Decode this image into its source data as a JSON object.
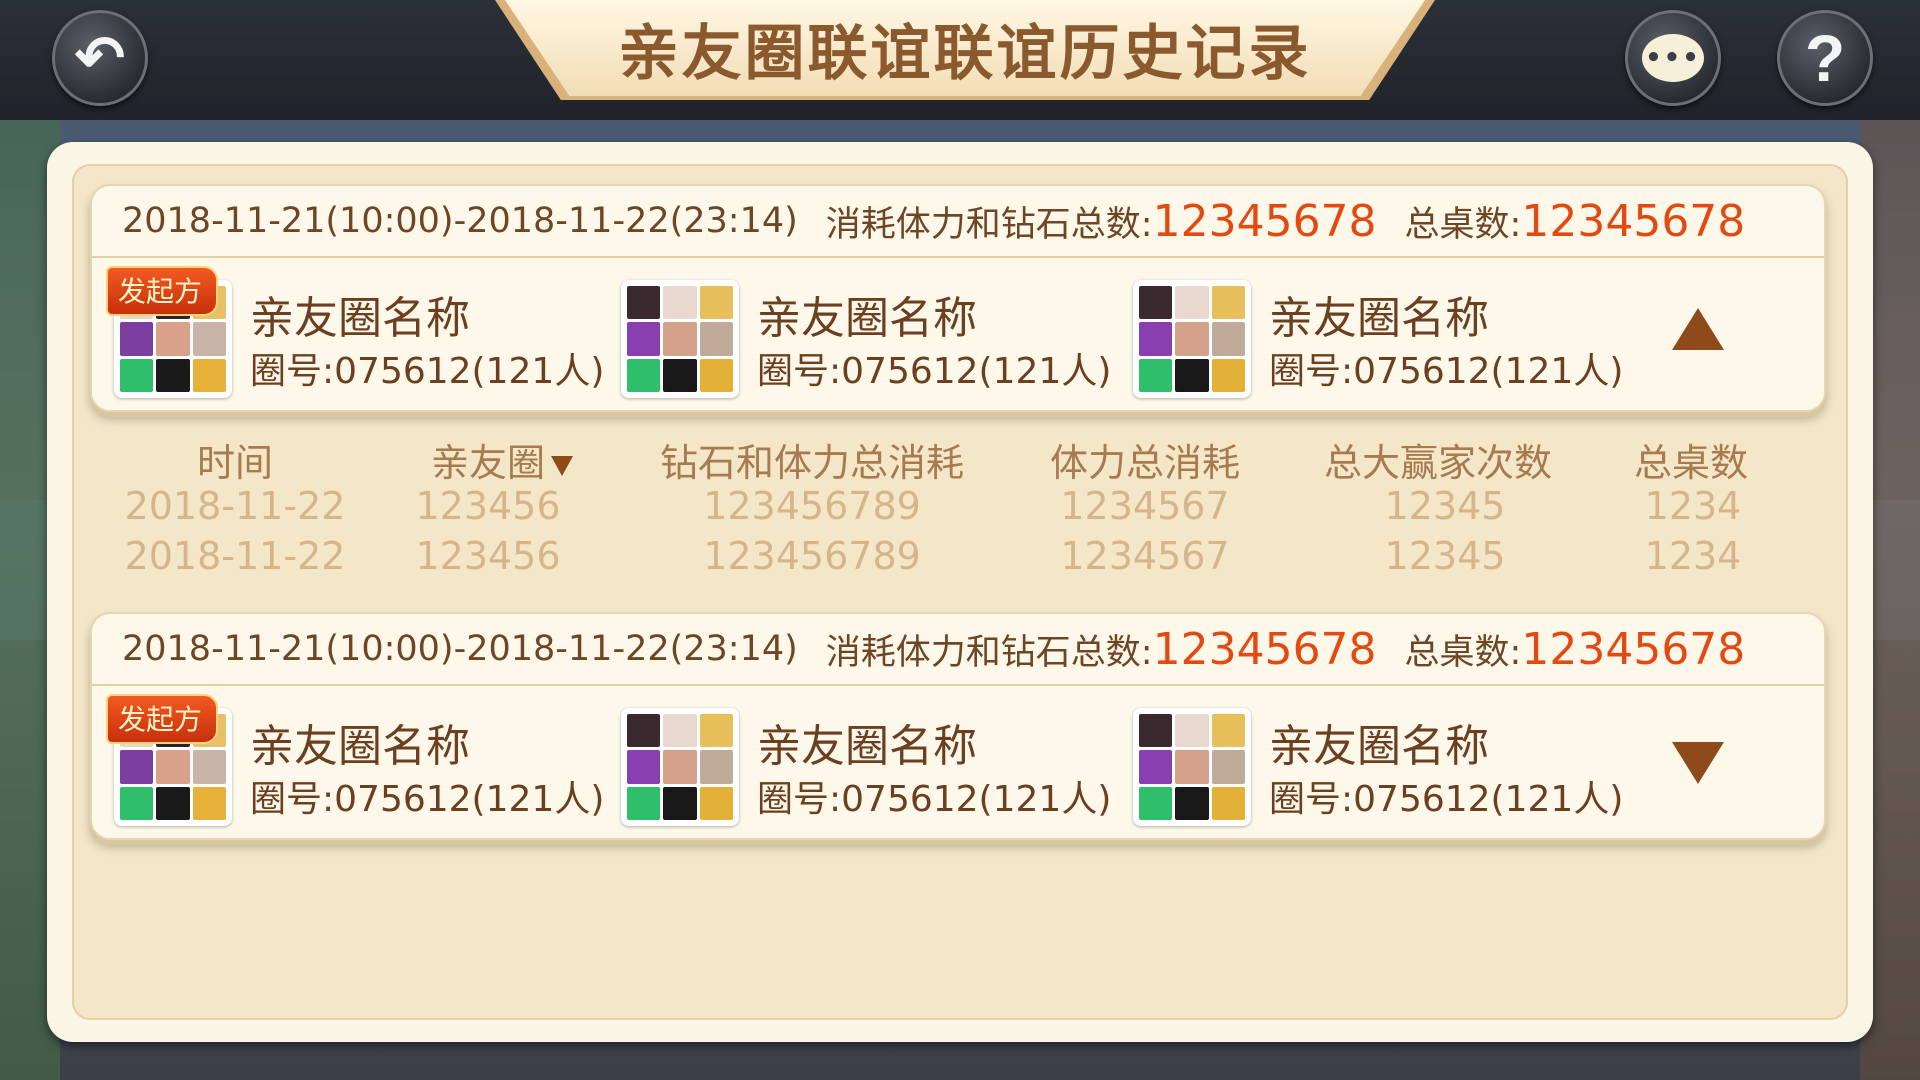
{
  "title": "亲友圈联谊联谊历史记录",
  "topbar": {
    "back_glyph": "↶",
    "chat_glyph": "•••",
    "help_glyph": "?"
  },
  "records": [
    {
      "period": "2018-11-21(10:00)-2018-11-22(23:14)",
      "consumption_label": "消耗体力和钻石总数:",
      "consumption_value": "12345678",
      "tables_label": "总桌数:",
      "tables_value": "12345678",
      "initiator_label": "发起方",
      "clubs": [
        {
          "name": "亲友圈名称",
          "id": "圈号:075612(121人)"
        },
        {
          "name": "亲友圈名称",
          "id": "圈号:075612(121人)"
        },
        {
          "name": "亲友圈名称",
          "id": "圈号:075612(121人)"
        }
      ],
      "toggle": "up"
    },
    {
      "period": "2018-11-21(10:00)-2018-11-22(23:14)",
      "consumption_label": "消耗体力和钻石总数:",
      "consumption_value": "12345678",
      "tables_label": "总桌数:",
      "tables_value": "12345678",
      "initiator_label": "发起方",
      "clubs": [
        {
          "name": "亲友圈名称",
          "id": "圈号:075612(121人)"
        },
        {
          "name": "亲友圈名称",
          "id": "圈号:075612(121人)"
        },
        {
          "name": "亲友圈名称",
          "id": "圈号:075612(121人)"
        }
      ],
      "toggle": "down"
    }
  ],
  "detail_table": {
    "headers": [
      "时间",
      "亲友圈",
      "钻石和体力总消耗",
      "体力总消耗",
      "总大赢家次数",
      "总桌数"
    ],
    "rows": [
      [
        "2018-11-22",
        "123456",
        "123456789",
        "1234567",
        "12345",
        "1234"
      ],
      [
        "2018-11-22",
        "123456",
        "123456789",
        "1234567",
        "12345",
        "1234"
      ]
    ]
  },
  "colors": {
    "accent_orange": "#e34a12",
    "brown_text": "#6b3f1f",
    "header_text": "#a77a4f",
    "cell_text": "#d7b58a",
    "arrow": "#8e4a1b"
  }
}
